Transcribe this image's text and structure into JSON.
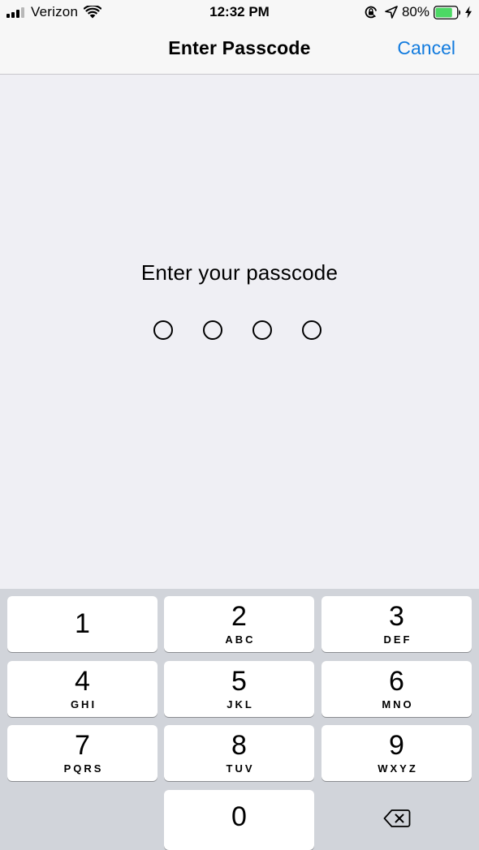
{
  "status_bar": {
    "carrier": "Verizon",
    "time": "12:32 PM",
    "battery_percent": "80%",
    "battery_level": 0.8,
    "battery_color": "#4cd964",
    "icons": [
      "signal-icon",
      "wifi-icon",
      "rotation-lock-icon",
      "location-icon",
      "battery-icon",
      "charging-icon"
    ]
  },
  "nav": {
    "title": "Enter Passcode",
    "cancel_label": "Cancel",
    "accent_color": "#127bde"
  },
  "prompt": {
    "text": "Enter your passcode",
    "digits_total": 4,
    "digits_entered": 0
  },
  "keypad": {
    "keys": [
      {
        "digit": "1",
        "letters": ""
      },
      {
        "digit": "2",
        "letters": "ABC"
      },
      {
        "digit": "3",
        "letters": "DEF"
      },
      {
        "digit": "4",
        "letters": "GHI"
      },
      {
        "digit": "5",
        "letters": "JKL"
      },
      {
        "digit": "6",
        "letters": "MNO"
      },
      {
        "digit": "7",
        "letters": "PQRS"
      },
      {
        "digit": "8",
        "letters": "TUV"
      },
      {
        "digit": "9",
        "letters": "WXYZ"
      },
      {
        "digit": "0",
        "letters": ""
      }
    ],
    "delete_icon": "backspace-icon"
  }
}
